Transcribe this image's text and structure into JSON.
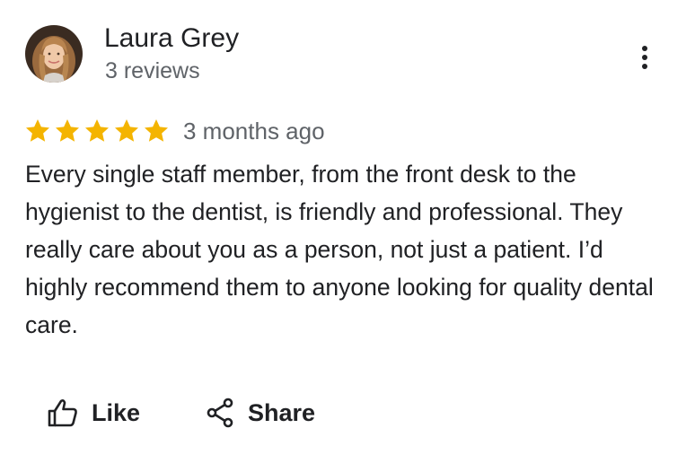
{
  "reviewer": {
    "name": "Laura Grey",
    "review_count": "3 reviews"
  },
  "review": {
    "rating": 5,
    "max_rating": 5,
    "date": "3 months ago",
    "text": "Every single staff member, from the front desk to the hygienist to the dentist, is friendly and professional. They really care about you as a person, not just a patient. I’d highly recommend them to anyone looking for quality dental care."
  },
  "actions": {
    "like_label": "Like",
    "share_label": "Share"
  },
  "icons": {
    "more": "more-vert-icon",
    "star": "star-icon",
    "like": "thumb-up-icon",
    "share": "share-icon"
  },
  "colors": {
    "star": "#F4B400",
    "text_primary": "#202124",
    "text_secondary": "#5f6368"
  }
}
